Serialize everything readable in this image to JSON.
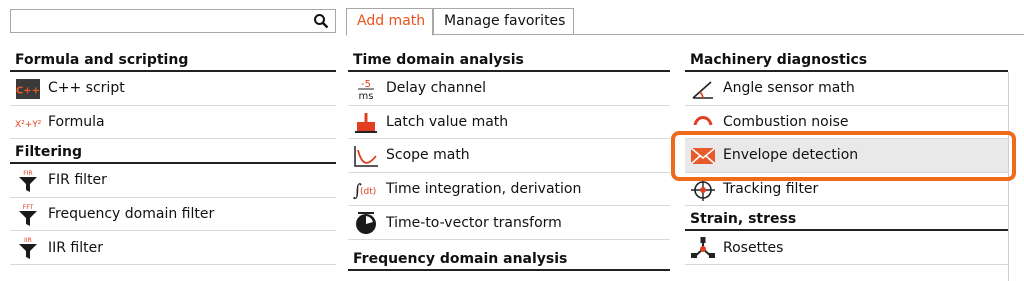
{
  "search": {
    "value": "",
    "placeholder": ""
  },
  "tabs": [
    {
      "label": "Add math",
      "active": true
    },
    {
      "label": "Manage favorites",
      "active": false
    }
  ],
  "columns": [
    {
      "sections": [
        {
          "header": "Formula and scripting",
          "items": [
            {
              "label": "C++ script",
              "icon": "cpp-icon"
            },
            {
              "label": "Formula",
              "icon": "formula-icon"
            }
          ]
        },
        {
          "header": "Filtering",
          "items": [
            {
              "label": "FIR filter",
              "icon": "fir-filter-icon",
              "tag": "FIR"
            },
            {
              "label": "Frequency domain filter",
              "icon": "fft-filter-icon",
              "tag": "FFT"
            },
            {
              "label": "IIR filter",
              "icon": "iir-filter-icon",
              "tag": "IIR"
            }
          ]
        }
      ]
    },
    {
      "sections": [
        {
          "header": "Time domain analysis",
          "items": [
            {
              "label": "Delay channel",
              "icon": "delay-icon"
            },
            {
              "label": "Latch value math",
              "icon": "latch-icon"
            },
            {
              "label": "Scope math",
              "icon": "scope-icon"
            },
            {
              "label": "Time integration, derivation",
              "icon": "integration-icon"
            },
            {
              "label": "Time-to-vector transform",
              "icon": "clock-icon"
            }
          ]
        },
        {
          "header": "Frequency domain analysis",
          "items": []
        }
      ]
    },
    {
      "sections": [
        {
          "header": "Machinery diagnostics",
          "items": [
            {
              "label": "Angle sensor math",
              "icon": "angle-icon"
            },
            {
              "label": "Combustion noise",
              "icon": "combustion-icon"
            },
            {
              "label": "Envelope detection",
              "icon": "envelope-icon",
              "highlighted": true
            },
            {
              "label": "Tracking filter",
              "icon": "tracking-icon"
            }
          ]
        },
        {
          "header": "Strain, stress",
          "items": [
            {
              "label": "Rosettes",
              "icon": "rosette-icon"
            }
          ]
        }
      ]
    }
  ],
  "icon_text": {
    "delay_top": "-5",
    "delay_bottom": "ms",
    "formula": "X²+Y²",
    "cpp": "C++",
    "integration": "(dt)"
  },
  "colors": {
    "accent": "#e8531e",
    "highlight_border": "#ef6a1a"
  }
}
